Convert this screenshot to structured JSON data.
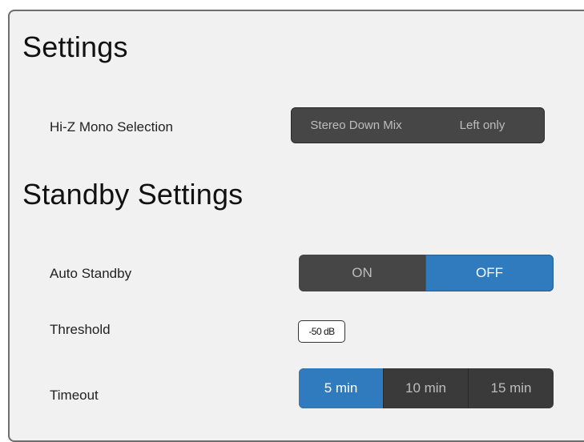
{
  "settings": {
    "title": "Settings",
    "hiz_mono": {
      "label": "Hi-Z Mono Selection",
      "options": [
        "Stereo Down Mix",
        "Left only"
      ],
      "selected": null
    }
  },
  "standby": {
    "title": "Standby Settings",
    "auto_standby": {
      "label": "Auto Standby",
      "options": [
        "ON",
        "OFF"
      ],
      "selected": "OFF"
    },
    "threshold": {
      "label": "Threshold",
      "value": "-50 dB"
    },
    "timeout": {
      "label": "Timeout",
      "options": [
        "5 min",
        "10 min",
        "15 min"
      ],
      "selected": "5 min"
    }
  },
  "colors": {
    "active": "#2f7bbd",
    "inactive": "#464646",
    "panel_bg": "#f1f1f1"
  }
}
